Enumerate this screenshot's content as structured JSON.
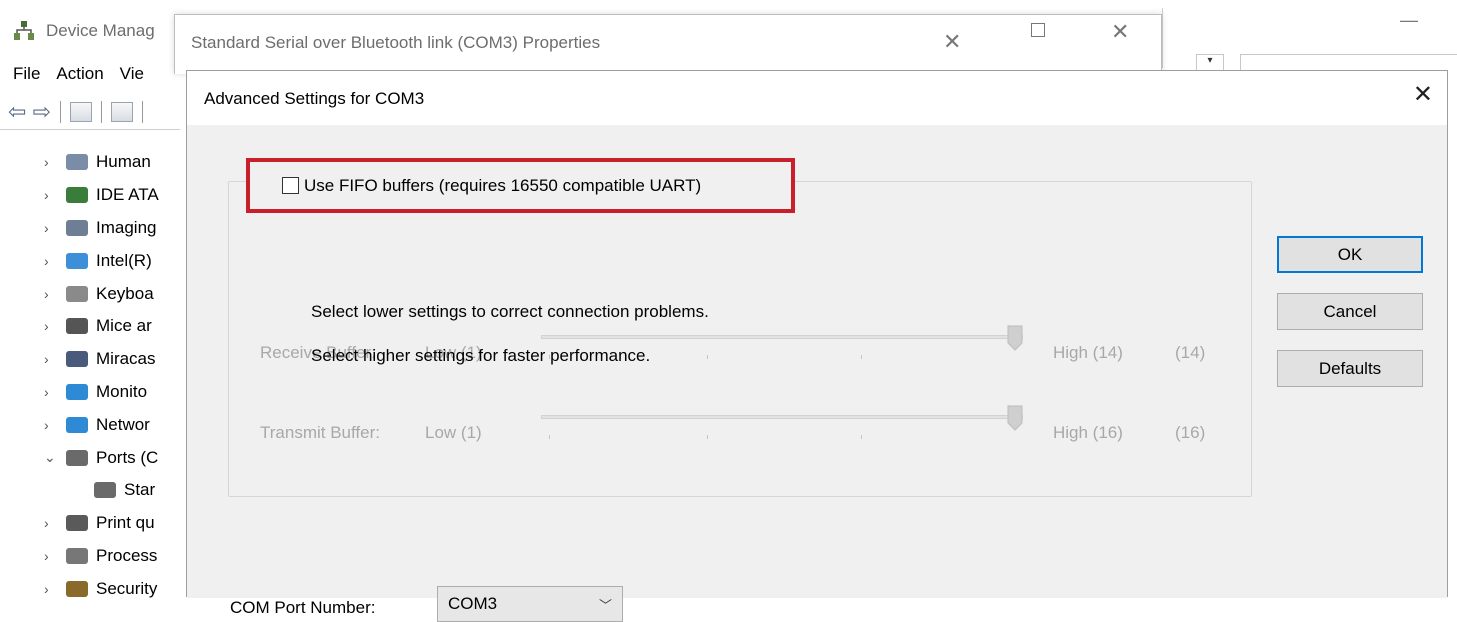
{
  "device_manager": {
    "title": "Device Manag",
    "menu": [
      "File",
      "Action",
      "Vie"
    ],
    "tree": [
      {
        "label": "Human",
        "expanded": false,
        "icon": "hid-icon",
        "color": "#7a8ca8"
      },
      {
        "label": "IDE ATA",
        "expanded": false,
        "icon": "ide-controller-icon",
        "color": "#3a7d3a"
      },
      {
        "label": "Imaging",
        "expanded": false,
        "icon": "imaging-icon",
        "color": "#6e7f95"
      },
      {
        "label": "Intel(R)",
        "expanded": false,
        "icon": "intel-icon",
        "color": "#3d8fd8"
      },
      {
        "label": "Keyboa",
        "expanded": false,
        "icon": "keyboard-icon",
        "color": "#8a8a8a"
      },
      {
        "label": "Mice ar",
        "expanded": false,
        "icon": "mouse-icon",
        "color": "#555555"
      },
      {
        "label": "Miracas",
        "expanded": false,
        "icon": "miracast-icon",
        "color": "#4a5a7a"
      },
      {
        "label": "Monito",
        "expanded": false,
        "icon": "monitor-icon",
        "color": "#2f8ad6"
      },
      {
        "label": "Networ",
        "expanded": false,
        "icon": "network-icon",
        "color": "#2f8ad6"
      },
      {
        "label": "Ports (C",
        "expanded": true,
        "icon": "port-icon",
        "color": "#6a6a6a"
      },
      {
        "label": "Star",
        "child": true,
        "icon": "port-icon",
        "color": "#6a6a6a"
      },
      {
        "label": "Print qu",
        "expanded": false,
        "icon": "printer-icon",
        "color": "#5a5a5a"
      },
      {
        "label": "Process",
        "expanded": false,
        "icon": "processor-icon",
        "color": "#777777"
      },
      {
        "label": "Security",
        "expanded": false,
        "icon": "security-icon",
        "color": "#8a6a2a"
      }
    ]
  },
  "properties_dialog": {
    "title": "Standard Serial over Bluetooth link (COM3) Properties"
  },
  "advanced_dialog": {
    "title": "Advanced Settings for COM3",
    "fifo": {
      "label": "Use FIFO buffers (requires 16550 compatible UART)",
      "checked": false
    },
    "hint_lower": "Select lower settings to correct connection problems.",
    "hint_higher": "Select higher settings for faster performance.",
    "receive_buffer": {
      "label": "Receive Buffer:",
      "low": "Low (1)",
      "high": "High (14)",
      "value_text": "(14)",
      "level": 1.0
    },
    "transmit_buffer": {
      "label": "Transmit Buffer:",
      "low": "Low (1)",
      "high": "High (16)",
      "value_text": "(16)",
      "level": 1.0
    },
    "com_port": {
      "label": "COM Port Number:",
      "selected": "COM3"
    },
    "buttons": {
      "ok": "OK",
      "cancel": "Cancel",
      "defaults": "Defaults"
    }
  },
  "colors": {
    "highlight_border": "#c8202a",
    "focus_border": "#0078d7",
    "disabled_text": "#a8a8a8",
    "dialog_body": "#f0f0f0"
  }
}
